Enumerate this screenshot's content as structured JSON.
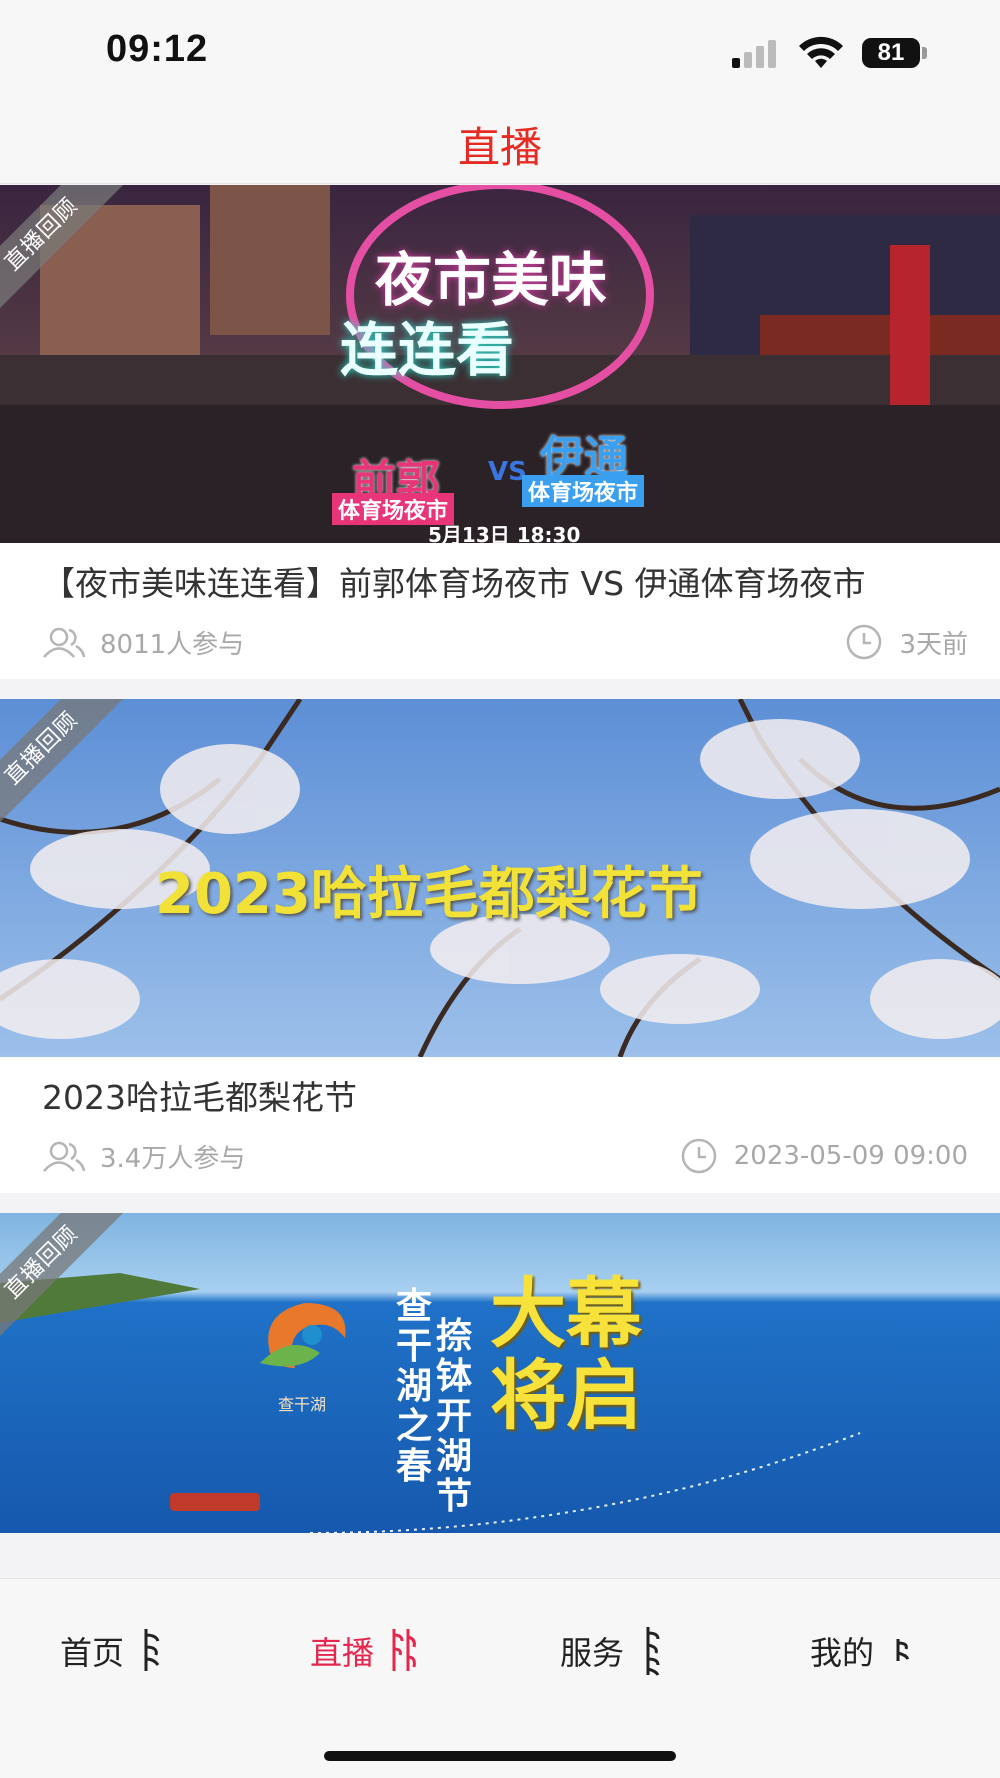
{
  "status_bar": {
    "time": "09:12",
    "battery": "81"
  },
  "header": {
    "title": "直播"
  },
  "cards": [
    {
      "badge": "直播回顾",
      "overlay_title_1": "夜市美味",
      "overlay_title_2": "连连看",
      "overlay_left": "前郭",
      "overlay_left_sub": "体育场夜市",
      "overlay_vs": "VS",
      "overlay_right": "伊通",
      "overlay_right_sub": "体育场夜市",
      "overlay_date": "5月13日 18:30",
      "title": "【夜市美味连连看】前郭体育场夜市 VS 伊通体育场夜市",
      "participants": "8011人参与",
      "time": "3天前"
    },
    {
      "badge": "直播回顾",
      "overlay_title": "2023哈拉毛都梨花节",
      "title": "2023哈拉毛都梨花节",
      "participants": "3.4万人参与",
      "time": "2023-05-09 09:00"
    },
    {
      "badge": "直播回顾",
      "overlay_col1": "查干湖之春",
      "overlay_col2": "捺钵开湖节",
      "overlay_big": "大幕将启",
      "overlay_logo_text": "查干湖"
    }
  ],
  "tabs": [
    {
      "label": "首页",
      "active": false
    },
    {
      "label": "直播",
      "active": true
    },
    {
      "label": "服务",
      "active": false
    },
    {
      "label": "我的",
      "active": false
    }
  ],
  "colors": {
    "accent": "#e62b24",
    "tab_active": "#e5264f",
    "meta_gray": "#a8a8a8"
  }
}
